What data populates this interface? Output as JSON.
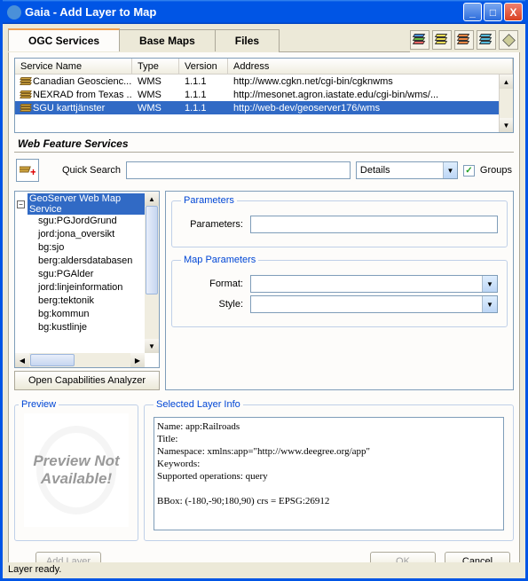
{
  "window": {
    "title": "Gaia - Add Layer to Map"
  },
  "tabs": {
    "ogc": "OGC Services",
    "base": "Base Maps",
    "files": "Files"
  },
  "services": {
    "headers": {
      "name": "Service Name",
      "type": "Type",
      "version": "Version",
      "address": "Address"
    },
    "rows": [
      {
        "name": "Canadian Geoscienc...",
        "type": "WMS",
        "version": "1.1.1",
        "address": "http://www.cgkn.net/cgi-bin/cgknwms"
      },
      {
        "name": "NEXRAD from Texas ...",
        "type": "WMS",
        "version": "1.1.1",
        "address": "http://mesonet.agron.iastate.edu/cgi-bin/wms/..."
      },
      {
        "name": "SGU karttjänster",
        "type": "WMS",
        "version": "1.1.1",
        "address": "http://web-dev/geoserver176/wms"
      }
    ]
  },
  "wfs_header": "Web Feature Services",
  "quicksearch": {
    "label": "Quick Search",
    "value": "",
    "details_label": "Details",
    "groups_label": "Groups",
    "groups_checked": true
  },
  "tree": {
    "root": "GeoServer Web Map Service",
    "children": [
      "sgu:PGJordGrund",
      "jord:jona_oversikt",
      "bg:sjo",
      "berg:aldersdatabasen",
      "sgu:PGAlder",
      "jord:linjeinformation",
      "berg:tektonik",
      "bg:kommun",
      "bg:kustlinje"
    ]
  },
  "oca_button": "Open Capabilities Analyzer",
  "params": {
    "legend_params": "Parameters",
    "label_params": "Parameters:",
    "legend_map": "Map Parameters",
    "label_format": "Format:",
    "label_style": "Style:"
  },
  "preview": {
    "legend": "Preview",
    "text": "Preview Not Available!"
  },
  "sli": {
    "legend": "Selected Layer Info",
    "text": "Name: app:Railroads\nTitle:\nNamespace: xmlns:app=\"http://www.deegree.org/app\"\nKeywords:\nSupported operations: query\n\nBBox: (-180,-90;180,90) crs = EPSG:26912"
  },
  "buttons": {
    "add": "Add Layer",
    "ok": "OK",
    "cancel": "Cancel"
  },
  "status": "Layer ready."
}
